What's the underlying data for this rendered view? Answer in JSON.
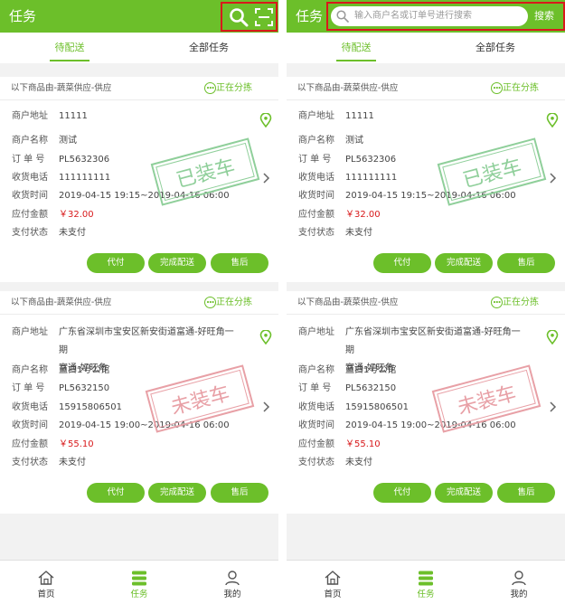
{
  "header": {
    "title": "任务",
    "search_placeholder": "输入商户名或订单号进行搜索",
    "search_button": "搜索"
  },
  "tabs": [
    {
      "label": "待配送",
      "active": true
    },
    {
      "label": "全部任务",
      "active": false
    }
  ],
  "field_labels": {
    "address": "商户地址",
    "name": "商户名称",
    "order_no": "订 单 号",
    "phone": "收货电话",
    "time": "收货时间",
    "amount": "应付金额",
    "pay_status": "支付状态"
  },
  "orders": [
    {
      "supplier": "以下商品由-蔬菜供应-供应",
      "status": "正在分拣",
      "address": "11111",
      "name": "测试",
      "order_no": "PL5632306",
      "phone": "111111111",
      "time": "2019-04-15 19:15~2019-04-16 06:00",
      "amount": "￥32.00",
      "pay_status": "未支付",
      "stamp": "已装车",
      "stamp_color": "#8fcf9a"
    },
    {
      "supplier": "以下商品由-蔬菜供应-供应",
      "status": "正在分拣",
      "address_line1": "广东省深圳市宝安区新安街道富通-好旺角一期",
      "address_line2": "富通-好旺角",
      "name": "蓝白1号公馆",
      "order_no": "PL5632150",
      "phone": "15915806501",
      "time": "2019-04-15 19:00~2019-04-16 06:00",
      "amount": "￥55.10",
      "pay_status": "未支付",
      "stamp": "未装车",
      "stamp_color": "#e8a0a6"
    }
  ],
  "actions": [
    "代付",
    "完成配送",
    "售后"
  ],
  "bottom_nav": [
    {
      "label": "首页",
      "icon": "home-icon"
    },
    {
      "label": "任务",
      "icon": "task-list-icon",
      "active": true
    },
    {
      "label": "我的",
      "icon": "user-icon"
    }
  ],
  "colors": {
    "brand_green": "#6cbf2a",
    "highlight_red": "#d8191b",
    "price_red": "#d8191b"
  },
  "icons": {
    "search": "search-icon",
    "scan": "scan-icon",
    "location": "location-pin-icon",
    "chevron": "chevron-right-icon",
    "status": "more-dots-icon"
  }
}
